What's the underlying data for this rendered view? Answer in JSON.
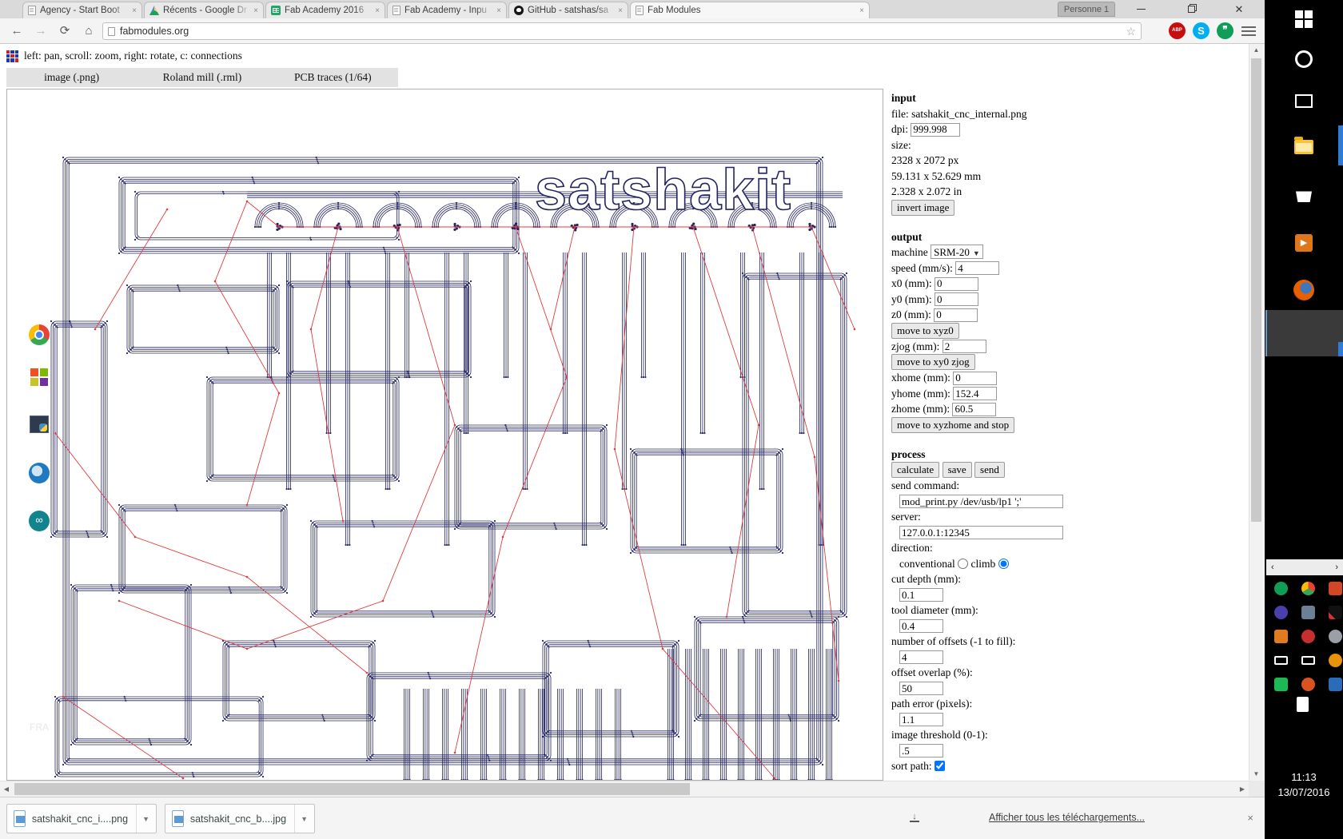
{
  "browser": {
    "tabs": [
      {
        "label": "Agency - Start Boot",
        "favicon": "doc-icon"
      },
      {
        "label": "Récents - Google Dr",
        "favicon": "drive-icon"
      },
      {
        "label": "Fab Academy 2016",
        "favicon": "sheets-icon"
      },
      {
        "label": "Fab Academy - Inpu",
        "favicon": "doc-icon"
      },
      {
        "label": "GitHub - satshas/sa",
        "favicon": "github-icon"
      },
      {
        "label": "Fab Modules",
        "favicon": "doc-icon"
      }
    ],
    "close_glyph": "×",
    "profile_label": "Personne 1",
    "nav": {
      "url": "fabmodules.org",
      "back": "←",
      "forward": "→",
      "reload": "⟳",
      "home": "⌂",
      "star": "☆"
    },
    "extensions": {
      "abp": "ABP",
      "skype": "S",
      "hangouts": "❞"
    }
  },
  "page": {
    "hint": "left: pan, scroll: zoom, right: rotate, c: connections",
    "modtabs": [
      "image (.png)",
      "Roland mill (.rml)",
      "PCB traces (1/64)"
    ],
    "canvas_watermark": "satshakit",
    "panel": {
      "input": {
        "header": "input",
        "file_line": "file: satshakit_cnc_internal.png",
        "dpi_label": "dpi:",
        "dpi_value": "999.998",
        "size_label": "size:",
        "size_px": "2328 x 2072 px",
        "size_mm": "59.131 x 52.629 mm",
        "size_in": "2.328 x 2.072 in",
        "invert_button": "invert image"
      },
      "output": {
        "header": "output",
        "machine_label": "machine",
        "machine_value": "SRM-20",
        "speed_label": "speed (mm/s):",
        "speed_value": "4",
        "x0_label": "x0 (mm):",
        "x0_value": "0",
        "y0_label": "y0 (mm):",
        "y0_value": "0",
        "z0_label": "z0 (mm):",
        "z0_value": "0",
        "move_xyz0": "move to xyz0",
        "zjog_label": "zjog (mm):",
        "zjog_value": "2",
        "move_xy0_zjog": "move to xy0 zjog",
        "xhome_label": "xhome (mm):",
        "xhome_value": "0",
        "yhome_label": "yhome (mm):",
        "yhome_value": "152.4",
        "zhome_label": "zhome (mm):",
        "zhome_value": "60.5",
        "move_home": "move to xyzhome and stop"
      },
      "process": {
        "header": "process",
        "calculate": "calculate",
        "save": "save",
        "send": "send",
        "send_command_label": "send command:",
        "send_command_value": "mod_print.py /dev/usb/lp1 ';'",
        "server_label": "server:",
        "server_value": "127.0.0.1:12345",
        "direction_label": "direction:",
        "conventional_label": "conventional",
        "climb_label": "climb",
        "climb_selected": true,
        "cut_depth_label": "cut depth (mm):",
        "cut_depth_value": "0.1",
        "tool_diameter_label": "tool diameter (mm):",
        "tool_diameter_value": "0.4",
        "offsets_label": "number of offsets (-1 to fill):",
        "offsets_value": "4",
        "overlap_label": "offset overlap (%):",
        "overlap_value": "50",
        "path_error_label": "path error (pixels):",
        "path_error_value": "1.1",
        "threshold_label": "image threshold (0-1):",
        "threshold_value": ".5",
        "sort_path_label": "sort path:",
        "sort_path_checked": true
      }
    }
  },
  "downloads": {
    "items": [
      {
        "name": "satshakit_cnc_i....png"
      },
      {
        "name": "satshakit_cnc_b....jpg"
      }
    ],
    "show_all": "Afficher tous les téléchargements...",
    "close_glyph": "×"
  },
  "taskbar": {
    "language": "FRA",
    "time": "11:13",
    "date": "13/07/2016"
  },
  "colors": {
    "trace_navy": "#232360",
    "connection_red": "#e23c3c",
    "accent_blue": "#2e7cd6"
  }
}
